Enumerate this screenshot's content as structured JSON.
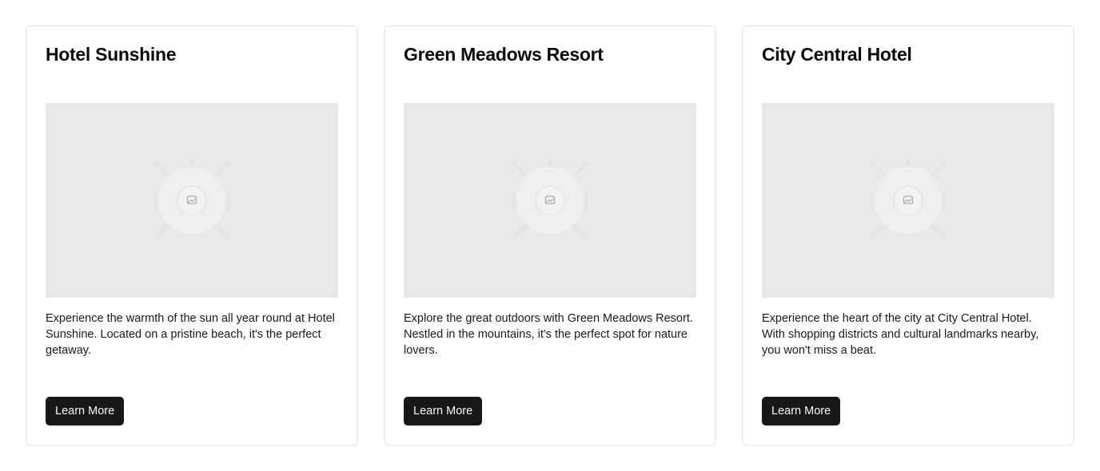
{
  "cards": [
    {
      "title": "Hotel Sunshine",
      "image_icon": "image-placeholder-icon",
      "description": "Experience the warmth of the sun all year round at Hotel Sunshine. Located on a pristine beach, it's the perfect getaway.",
      "button_label": "Learn More"
    },
    {
      "title": "Green Meadows Resort",
      "image_icon": "image-placeholder-icon",
      "description": "Explore the great outdoors with Green Meadows Resort. Nestled in the mountains, it's the perfect spot for nature lovers.",
      "button_label": "Learn More"
    },
    {
      "title": "City Central Hotel",
      "image_icon": "image-placeholder-icon",
      "description": "Experience the heart of the city at City Central Hotel. With shopping districts and cultural landmarks nearby, you won't miss a beat.",
      "button_label": "Learn More"
    }
  ],
  "colors": {
    "button_bg": "#18181b",
    "button_text": "#fafafa",
    "image_bg": "#e8e8e8",
    "card_border": "#e5e5e5"
  }
}
